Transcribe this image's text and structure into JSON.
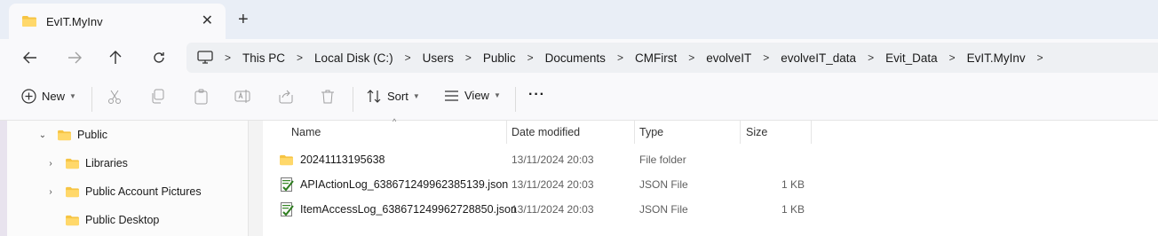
{
  "window": {
    "tab_title": "EvIT.MyInv",
    "tab_close": "✕",
    "new_tab": "+"
  },
  "address_bar": {
    "breadcrumbs": [
      "This PC",
      "Local Disk (C:)",
      "Users",
      "Public",
      "Documents",
      "CMFirst",
      "evolveIT",
      "evolveIT_data",
      "Evit_Data",
      "EvIT.MyInv"
    ]
  },
  "toolbar": {
    "new_label": "New",
    "sort_label": "Sort",
    "view_label": "View",
    "more_label": "···"
  },
  "nav_pane": {
    "items": [
      {
        "label": "Public",
        "expander": "⌄"
      },
      {
        "label": "Libraries",
        "expander": "›"
      },
      {
        "label": "Public Account Pictures",
        "expander": "›"
      },
      {
        "label": "Public Desktop",
        "expander": ""
      }
    ]
  },
  "file_list": {
    "columns": [
      "Name",
      "Date modified",
      "Type",
      "Size"
    ],
    "rows": [
      {
        "name": "20241113195638",
        "date": "13/11/2024 20:03",
        "type": "File folder",
        "size": "",
        "icon": "folder-icon"
      },
      {
        "name": "APIActionLog_638671249962385139.json",
        "date": "13/11/2024 20:03",
        "type": "JSON File",
        "size": "1 KB",
        "icon": "json-file-icon"
      },
      {
        "name": "ItemAccessLog_638671249962728850.json",
        "date": "13/11/2024 20:03",
        "type": "JSON File",
        "size": "1 KB",
        "icon": "json-file-icon"
      }
    ]
  },
  "colors": {
    "folder": "#f6c443",
    "titlebar": "#e9eef6"
  }
}
